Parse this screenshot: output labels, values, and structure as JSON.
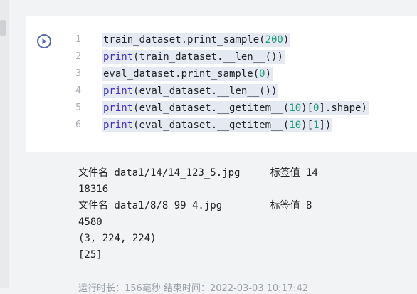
{
  "code_cell": {
    "lines": [
      {
        "number": "1",
        "parts": [
          {
            "t": "train_dataset.print_sample(",
            "c": ""
          },
          {
            "t": "200",
            "c": "num"
          },
          {
            "t": ")",
            "c": ""
          }
        ]
      },
      {
        "number": "2",
        "parts": [
          {
            "t": "print",
            "c": "kw"
          },
          {
            "t": "(train_dataset.__len__())",
            "c": ""
          }
        ]
      },
      {
        "number": "3",
        "parts": [
          {
            "t": "eval_dataset.print_sample(",
            "c": ""
          },
          {
            "t": "0",
            "c": "num"
          },
          {
            "t": ")",
            "c": ""
          }
        ]
      },
      {
        "number": "4",
        "parts": [
          {
            "t": "print",
            "c": "kw"
          },
          {
            "t": "(eval_dataset.__len__())",
            "c": ""
          }
        ]
      },
      {
        "number": "5",
        "parts": [
          {
            "t": "print",
            "c": "kw"
          },
          {
            "t": "(eval_dataset.__getitem__(",
            "c": ""
          },
          {
            "t": "10",
            "c": "num"
          },
          {
            "t": ")[",
            "c": ""
          },
          {
            "t": "0",
            "c": "num"
          },
          {
            "t": "].shape)",
            "c": ""
          }
        ]
      },
      {
        "number": "6",
        "parts": [
          {
            "t": "print",
            "c": "kw"
          },
          {
            "t": "(eval_dataset.__getitem__(",
            "c": ""
          },
          {
            "t": "10",
            "c": "num"
          },
          {
            "t": ")[",
            "c": ""
          },
          {
            "t": "1",
            "c": "num"
          },
          {
            "t": "])",
            "c": ""
          }
        ]
      }
    ]
  },
  "output": {
    "lines": [
      "文件名 data1/14/14_123_5.jpg     标签值 14",
      "18316",
      "文件名 data1/8/8_99_4.jpg        标签值 8",
      "4580",
      "(3, 224, 224)",
      "[25]"
    ]
  },
  "footer": {
    "text": "运行时长：156毫秒    结束时间：2022-03-03 10:17:42"
  },
  "icons": {
    "run": "play-circle-icon"
  },
  "colors": {
    "keyword": "#3b2fc4",
    "number": "#1a9a7e",
    "line_highlight": "#e5e9f1",
    "run_button": "#5a6bb4"
  }
}
